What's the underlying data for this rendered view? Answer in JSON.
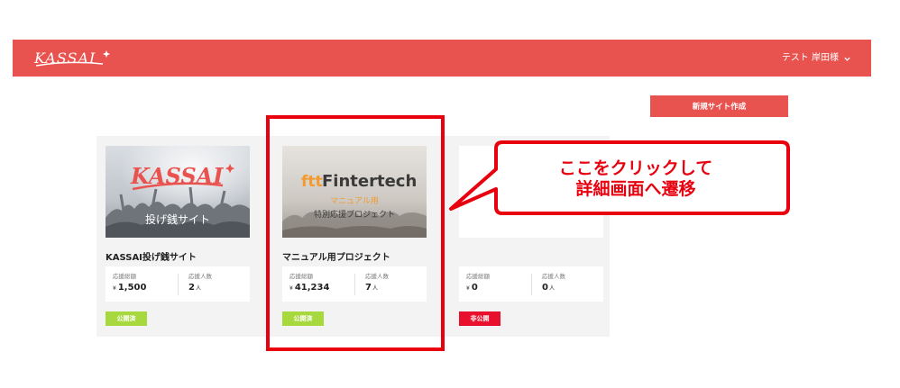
{
  "header": {
    "logo_text": "KASSAI",
    "user_name": "テスト 岸田様"
  },
  "new_site_button": "新規サイト作成",
  "cards": [
    {
      "title": "KASSAI投げ銭サイト",
      "image_logo": "KASSAI",
      "image_caption": "投げ銭サイト",
      "stats": {
        "total_label": "応援総額",
        "total_currency": "¥",
        "total_value": "1,500",
        "count_label": "応援人数",
        "count_value": "2",
        "count_unit": "人"
      },
      "status": "公開済",
      "status_color": "#a7d83e"
    },
    {
      "title": "マニュアル用プロジェクト",
      "image_logo": "Fintertech",
      "image_logo_mark": "ftt",
      "image_sub": "マニュアル用",
      "image_caption": "特別応援プロジェクト",
      "stats": {
        "total_label": "応援総額",
        "total_currency": "¥",
        "total_value": "41,234",
        "count_label": "応援人数",
        "count_value": "7",
        "count_unit": "人"
      },
      "status": "公開済",
      "status_color": "#a7d83e"
    },
    {
      "title": "",
      "stats": {
        "total_label": "応援総額",
        "total_currency": "¥",
        "total_value": "0",
        "count_label": "応援人数",
        "count_value": "0",
        "count_unit": "人"
      },
      "status": "非公開",
      "status_color": "#e8102c"
    }
  ],
  "annotation": {
    "line1": "ここをクリックして",
    "line2": "詳細画面へ遷移",
    "color": "#e8000f"
  },
  "colors": {
    "brand": "#e9534f",
    "panel_bg": "#f3f3f3"
  }
}
